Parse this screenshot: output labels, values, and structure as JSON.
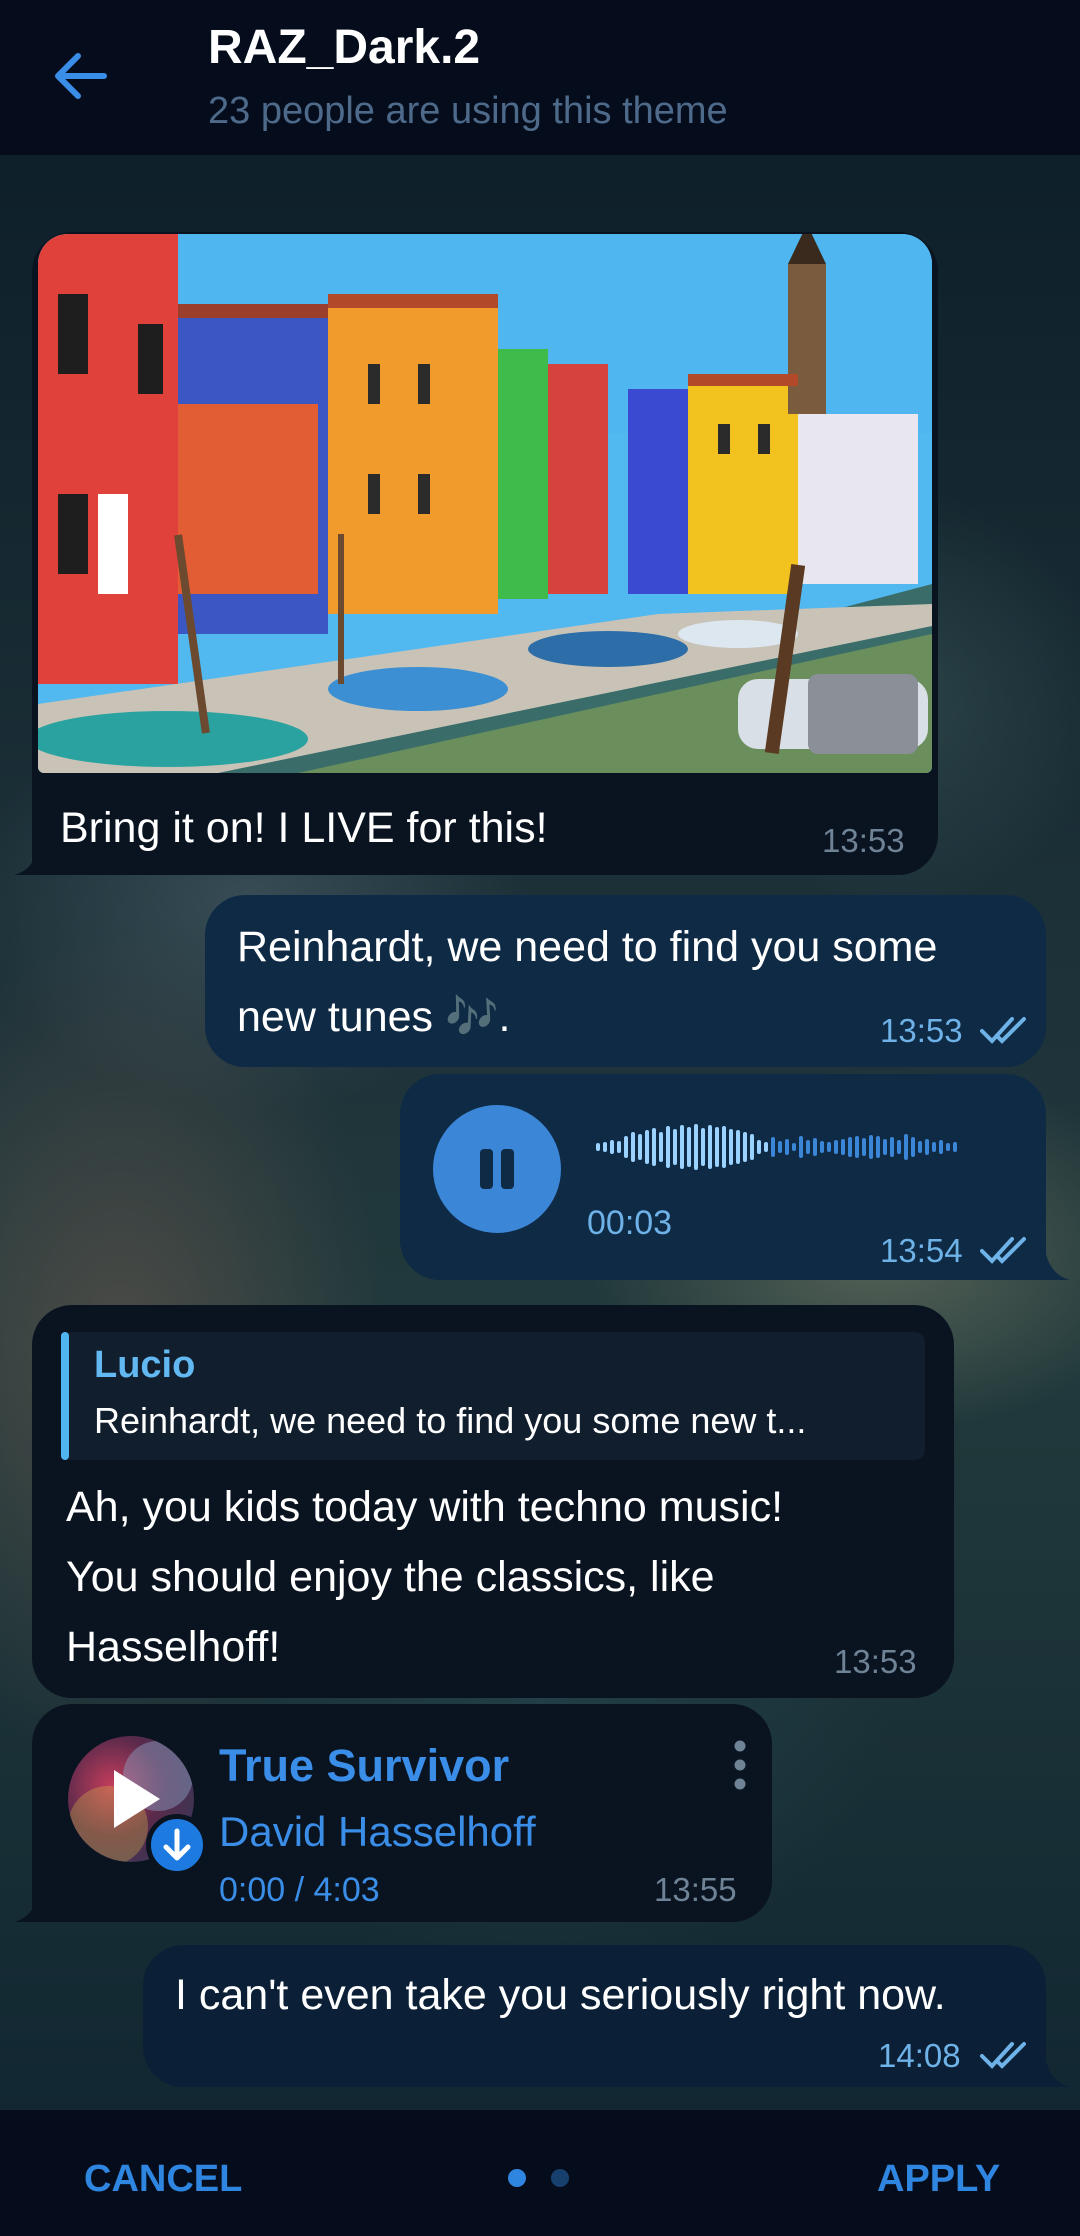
{
  "header": {
    "title": "RAZ_Dark.2",
    "subtitle": "23 people are using this theme"
  },
  "messages": {
    "photo_message": {
      "caption": "Bring it on! I LIVE for this!",
      "time": "13:53"
    },
    "out_message_1": {
      "line1": "Reinhardt, we need to find you some",
      "line2": "new tunes 🎶.",
      "time": "13:53"
    },
    "voice_message": {
      "elapsed": "00:03",
      "time": "13:54"
    },
    "reply_message": {
      "reply_author": "Lucio",
      "reply_preview": "Reinhardt, we need to find you some new t...",
      "line1": "Ah, you kids today with techno music!",
      "line2": "You should enjoy the classics, like",
      "line3": "Hasselhoff!",
      "time": "13:53"
    },
    "music_message": {
      "title": "True Survivor",
      "artist": "David Hasselhoff",
      "progress": "0:00 / 4:03",
      "time": "13:55"
    },
    "out_message_2": {
      "text": "I can't even take you seriously right now.",
      "time": "14:08"
    }
  },
  "footer": {
    "cancel_label": "CANCEL",
    "apply_label": "APPLY",
    "page_count": 2,
    "active_page": 1
  },
  "colors": {
    "accent": "#2f86e0",
    "header_bg": "#050d1c",
    "incoming_bubble": "#0a1320",
    "outgoing_bubble": "#0e2a45"
  },
  "icons": [
    "back-arrow-icon",
    "pause-icon",
    "double-check-icon",
    "play-icon",
    "download-icon",
    "more-vert-icon"
  ]
}
